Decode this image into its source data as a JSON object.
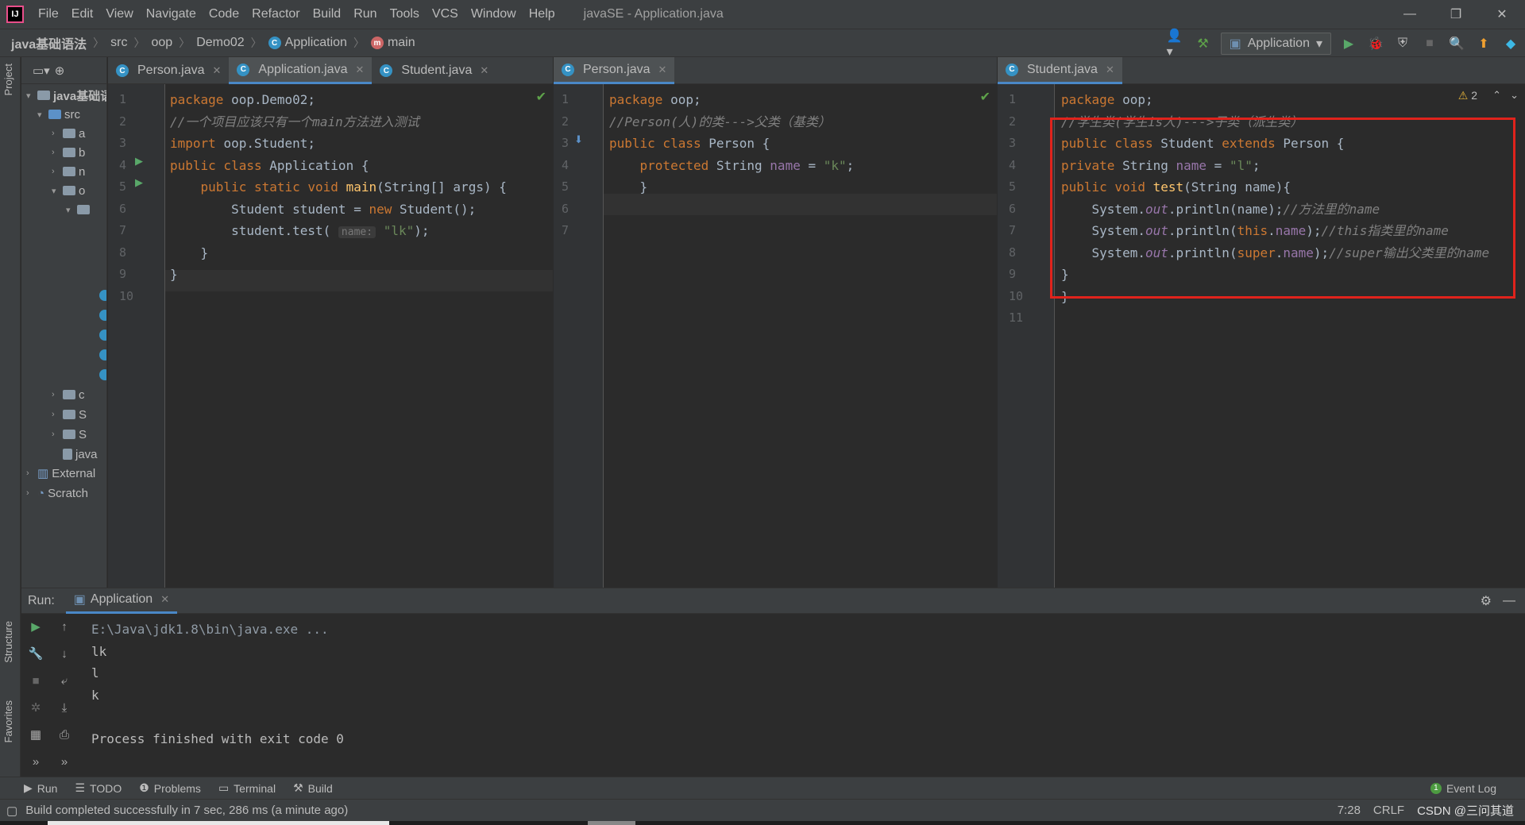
{
  "menubar": {
    "logo": "IJ",
    "items": [
      "File",
      "Edit",
      "View",
      "Navigate",
      "Code",
      "Refactor",
      "Build",
      "Run",
      "Tools",
      "VCS",
      "Window",
      "Help"
    ],
    "title": "javaSE - Application.java",
    "controls": [
      "—",
      "❐",
      "✕"
    ]
  },
  "breadcrumb": {
    "project": "java基础语法",
    "items": [
      "src",
      "oop",
      "Demo02",
      "Application",
      "main"
    ]
  },
  "toolbar": {
    "run_config": "Application",
    "icons": [
      "user-icon",
      "hammer-icon",
      "run-icon",
      "debug-icon",
      "coverage-icon",
      "stop-icon",
      "search-icon",
      "update-icon",
      "jetbrains-icon"
    ]
  },
  "left_strip": {
    "project_tab": "Project",
    "structure_tab": "Structure",
    "favorites_tab": "Favorites"
  },
  "project_tree": {
    "root": "java基础语法",
    "src": "src",
    "rows": [
      "a",
      "b",
      "n",
      "o",
      "",
      "c",
      "S",
      "S",
      "java",
      "External",
      "Scratch"
    ]
  },
  "editor_left": {
    "tabs": [
      "Person.java",
      "Application.java",
      "Student.java"
    ],
    "active_tab": 1,
    "line_numbers": [
      "1",
      "2",
      "3",
      "4",
      "5",
      "6",
      "7",
      "8",
      "9",
      "10"
    ],
    "lines": [
      [
        [
          "kw",
          "package "
        ],
        [
          "",
          "oop.Demo02;"
        ]
      ],
      [
        [
          "cm",
          "//一个项目应该只有一个main方法进入测试"
        ]
      ],
      [
        [
          "kw",
          "import "
        ],
        [
          "",
          "oop.Student;"
        ]
      ],
      [
        [
          "kw",
          "public class "
        ],
        [
          "",
          "Application {"
        ]
      ],
      [
        [
          "kw",
          "    public static void "
        ],
        [
          "fn",
          "main"
        ],
        [
          "",
          "(String[] args) {"
        ]
      ],
      [
        [
          "",
          "        Student student = "
        ],
        [
          "kw",
          "new "
        ],
        [
          "",
          "Student();"
        ]
      ],
      [
        [
          "",
          "        student.test( "
        ],
        [
          "hint",
          "name:"
        ],
        [
          "str",
          " \"lk\""
        ],
        [
          "",
          ");"
        ]
      ],
      [
        [
          "",
          "    }"
        ]
      ],
      [
        [
          "",
          "}"
        ]
      ],
      []
    ]
  },
  "editor_middle": {
    "tabs": [
      "Person.java"
    ],
    "line_numbers": [
      "1",
      "2",
      "3",
      "4",
      "5",
      "6",
      "7"
    ],
    "lines": [
      [
        [
          "kw",
          "package "
        ],
        [
          "",
          "oop;"
        ]
      ],
      [
        [
          "cm",
          "//Person(人)的类--->父类（基类）"
        ]
      ],
      [
        [
          "kw",
          "public class "
        ],
        [
          "",
          "Person {"
        ]
      ],
      [
        [
          "kw",
          "    protected "
        ],
        [
          "",
          "String "
        ],
        [
          "fld",
          "name"
        ],
        [
          "",
          " = "
        ],
        [
          "str",
          "\"k\""
        ],
        [
          "",
          ";"
        ]
      ],
      [
        [
          "",
          "    }"
        ]
      ],
      [],
      []
    ]
  },
  "editor_right": {
    "tabs": [
      "Student.java"
    ],
    "warnings": "2",
    "line_numbers": [
      "1",
      "2",
      "3",
      "4",
      "5",
      "6",
      "7",
      "8",
      "9",
      "10",
      "11"
    ],
    "lines": [
      [
        [
          "kw",
          "package "
        ],
        [
          "",
          "oop;"
        ]
      ],
      [
        [
          "cm",
          "//学生类(学生is人)--->子类（派生类）"
        ]
      ],
      [
        [
          "kw",
          "public class "
        ],
        [
          "",
          "Student "
        ],
        [
          "kw",
          "extends "
        ],
        [
          "",
          "Person {"
        ]
      ],
      [
        [
          "kw",
          "private "
        ],
        [
          "",
          "String "
        ],
        [
          "fld",
          "name"
        ],
        [
          "",
          " = "
        ],
        [
          "str",
          "\"l\""
        ],
        [
          "",
          ";"
        ]
      ],
      [
        [
          "kw",
          "public void "
        ],
        [
          "fn",
          "test"
        ],
        [
          "",
          "(String name){"
        ]
      ],
      [
        [
          "",
          "    System."
        ],
        [
          "st",
          "out"
        ],
        [
          "",
          ".println(name);"
        ],
        [
          "cm",
          "//方法里的name"
        ]
      ],
      [
        [
          "",
          "    System."
        ],
        [
          "st",
          "out"
        ],
        [
          "",
          ".println("
        ],
        [
          "kw",
          "this"
        ],
        [
          "",
          "."
        ],
        [
          "fld",
          "name"
        ],
        [
          "",
          ");"
        ],
        [
          "cm",
          "//this指类里的name"
        ]
      ],
      [
        [
          "",
          "    System."
        ],
        [
          "st",
          "out"
        ],
        [
          "",
          ".println("
        ],
        [
          "kw",
          "super"
        ],
        [
          "",
          "."
        ],
        [
          "fld",
          "name"
        ],
        [
          "",
          ");"
        ],
        [
          "cm",
          "//super输出父类里的name"
        ]
      ],
      [
        [
          "",
          "}"
        ]
      ],
      [
        [
          "",
          "}"
        ]
      ],
      []
    ]
  },
  "run_panel": {
    "label": "Run:",
    "tab": "Application",
    "console": [
      "E:\\Java\\jdk1.8\\bin\\java.exe ...",
      "lk",
      "l",
      "k",
      "",
      "Process finished with exit code 0"
    ]
  },
  "bottom_tabs": {
    "run": "Run",
    "todo": "TODO",
    "problems": "Problems",
    "terminal": "Terminal",
    "build": "Build",
    "event_log": "Event Log",
    "event_count": "1"
  },
  "status": {
    "message": "Build completed successfully in 7 sec, 286 ms (a minute ago)",
    "position": "7:28",
    "line_sep": "CRLF",
    "watermark": "CSDN @三问其道"
  },
  "colors": {
    "accent": "#4a88c7",
    "highlight_box": "#e0231c",
    "keyword": "#cc7832",
    "string": "#6a8759",
    "comment": "#808080"
  }
}
